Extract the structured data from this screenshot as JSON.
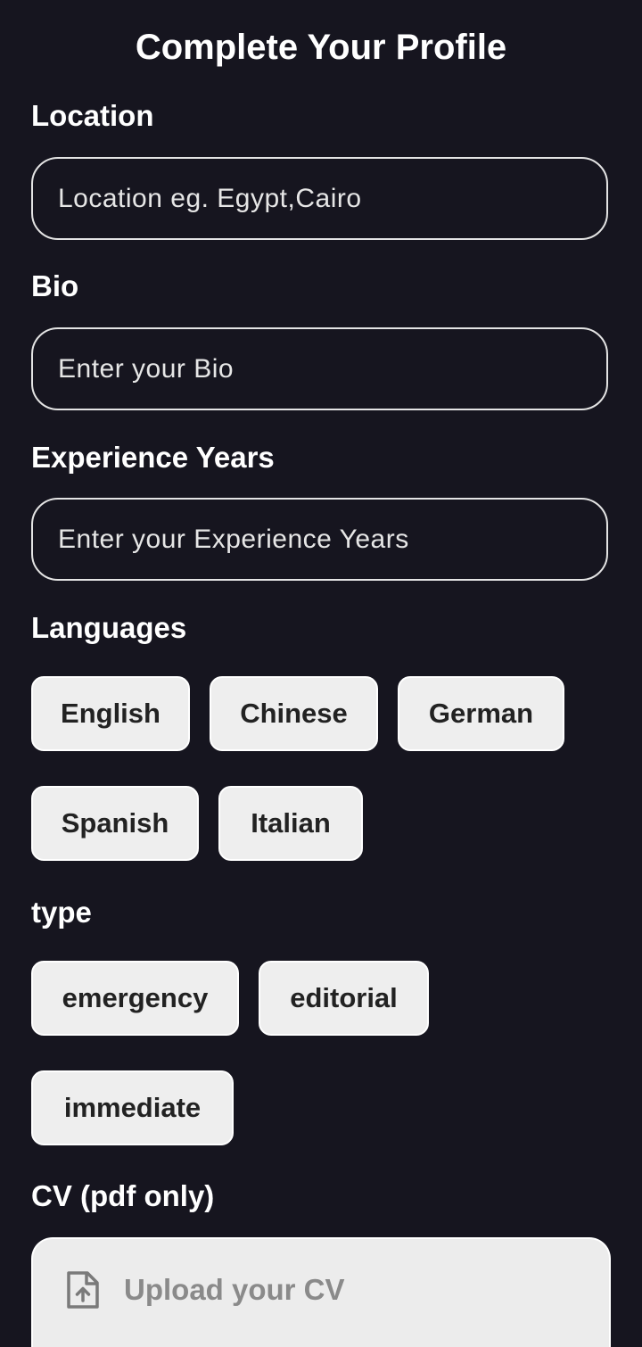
{
  "page": {
    "title": "Complete Your Profile"
  },
  "location": {
    "label": "Location",
    "placeholder": "Location eg. Egypt,Cairo",
    "value": ""
  },
  "bio": {
    "label": "Bio",
    "placeholder": "Enter your Bio",
    "value": ""
  },
  "experience": {
    "label": "Experience Years",
    "placeholder": "Enter your Experience Years",
    "value": ""
  },
  "languages": {
    "label": "Languages",
    "options": [
      {
        "label": "English"
      },
      {
        "label": "Chinese"
      },
      {
        "label": "German"
      },
      {
        "label": "Spanish"
      },
      {
        "label": "Italian"
      }
    ]
  },
  "type": {
    "label": "type",
    "options": [
      {
        "label": "emergency"
      },
      {
        "label": "editorial"
      },
      {
        "label": "immediate"
      }
    ]
  },
  "cv": {
    "label": "CV (pdf only)",
    "upload_label": "Upload your CV",
    "icon": "file-upload-icon"
  },
  "colors": {
    "background": "#16151f",
    "chip_background": "#eeeeee",
    "field_border": "#e4e4e4",
    "upload_text": "#8a8a8a"
  }
}
